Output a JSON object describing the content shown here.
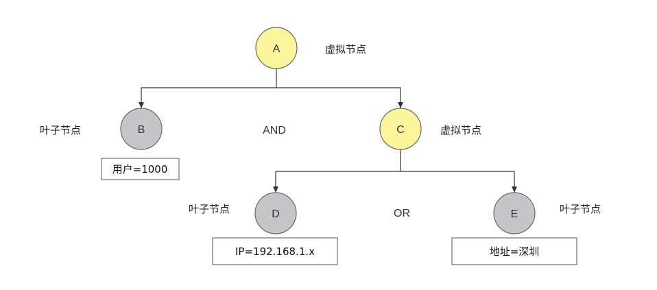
{
  "nodes": {
    "a": {
      "letter": "A",
      "label": "虚拟节点",
      "kind": "virtual"
    },
    "b": {
      "letter": "B",
      "label": "叶子节点",
      "kind": "leaf",
      "condition": "用户=1000"
    },
    "c": {
      "letter": "C",
      "label": "虚拟节点",
      "kind": "virtual"
    },
    "d": {
      "letter": "D",
      "label": "叶子节点",
      "kind": "leaf",
      "condition": "IP=192.168.1.x"
    },
    "e": {
      "letter": "E",
      "label": "叶子节点",
      "kind": "leaf",
      "condition": "地址=深圳"
    }
  },
  "operators": {
    "root": "AND",
    "c": "OR"
  },
  "colors": {
    "virtual_fill": "#fbf59c",
    "leaf_fill": "#c6c6c9",
    "node_stroke": "#666666",
    "edge": "#333333"
  }
}
